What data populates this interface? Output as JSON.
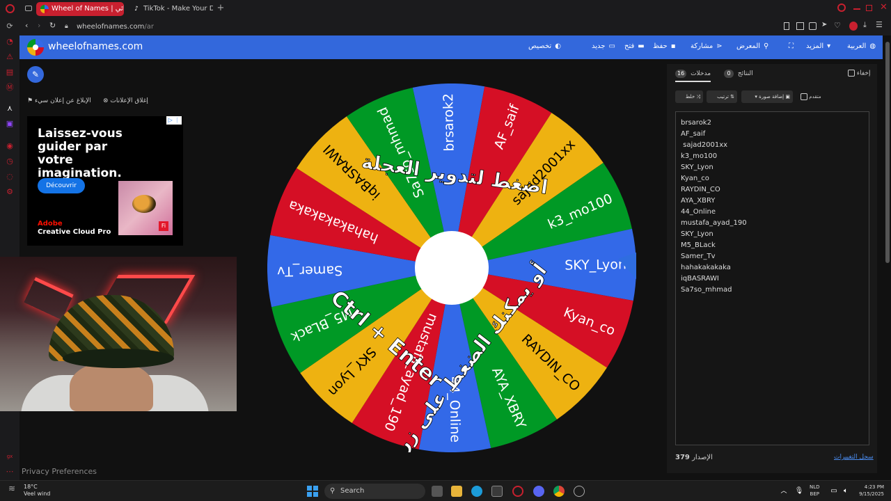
{
  "browser": {
    "tabs": [
      {
        "label": "Wheel of Names | عشوائي",
        "active": true
      },
      {
        "label": "TikTok - Make Your Day",
        "active": false
      }
    ],
    "url": "wheelofnames.com/ar",
    "url_host": "wheelofnames.com",
    "url_path": "/ar"
  },
  "header": {
    "site_title": "wheelofnames.com",
    "nav": {
      "language": "العربية",
      "more": "المزيد",
      "gallery": "المعرض",
      "share": "مشاركة",
      "save": "حفظ",
      "open": "فتح",
      "new": "جديد",
      "customize": "تخصيص"
    }
  },
  "ads": {
    "report_ad": "الإبلاغ عن إعلان سيء",
    "close_ads": "إغلاق الإعلانات",
    "headline": "Laissez-vous guider par votre imagination.",
    "cta": "Découvrir",
    "brand": "Adobe",
    "product": "Creative Cloud Pro",
    "badge": "Fi"
  },
  "privacy_link": "Privacy Preferences",
  "wheel": {
    "colors": [
      "#3369e8",
      "#d50f25",
      "#eeb211",
      "#009925"
    ],
    "overlay_top": "اضغط لتدوير العجلة",
    "overlay_bottom_1": "أو يمكنك الضغط على زر",
    "overlay_bottom_2": "Ctrl + Enter"
  },
  "panel": {
    "tab_entries": "مدخلات",
    "entries_count": "16",
    "tab_results": "النتائج",
    "results_count": "0",
    "hide": "إخفاء",
    "shuffle": "خلط",
    "sort": "ترتيب",
    "add_image": "إضافة صورة",
    "advanced": "متقدم",
    "entries": [
      "brsarok2",
      "AF_saif",
      " sajad2001xx",
      "k3_mo100",
      "SKY_Lyon",
      "Kyan_co",
      "RAYDIN_CO",
      "AYA_XBRY",
      "44_Online",
      "mustafa_ayad_190",
      "SKY_Lyon",
      "M5_BLack",
      "Samer_Tv",
      "hahakakakaka",
      "iqBASRAWI",
      "Sa7so_mhmad"
    ],
    "version_label": "الإصدار",
    "version_number": "379",
    "changelog": "سجل التغييرات"
  },
  "taskbar": {
    "temperature": "18°C",
    "weather": "Veel wind",
    "search": "Search",
    "lang_1": "NLD",
    "lang_2": "BEP",
    "time": "4:23 PM",
    "date": "9/15/2025"
  }
}
